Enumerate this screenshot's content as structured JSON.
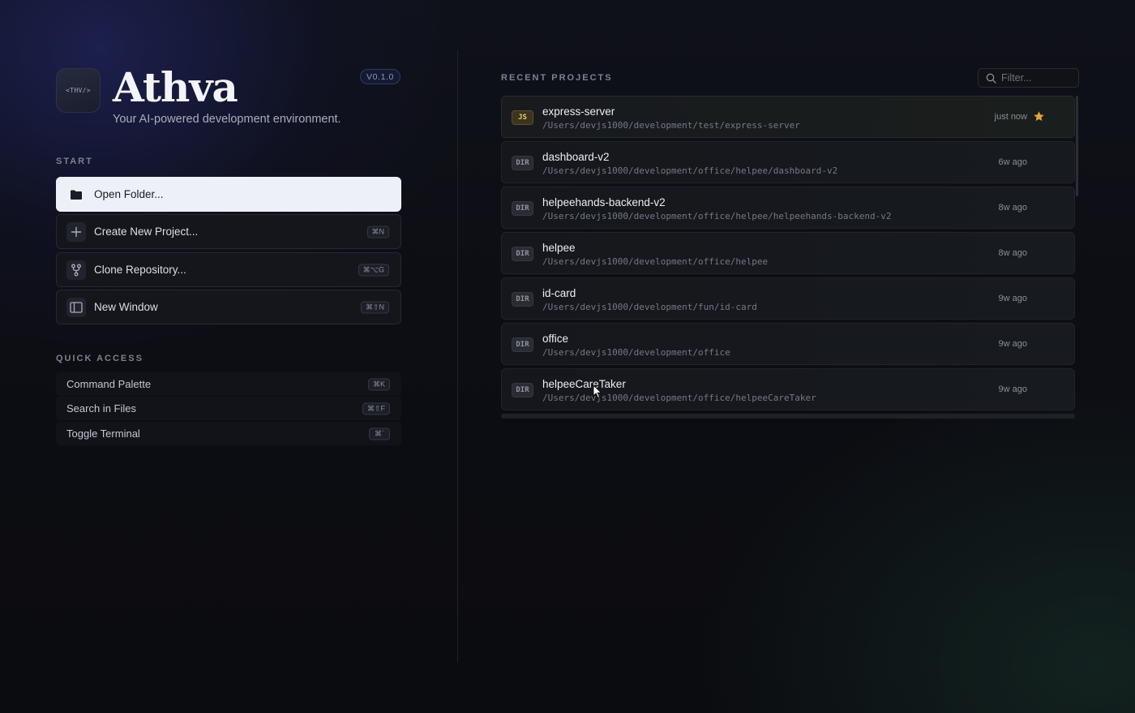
{
  "app": {
    "logo_text": "<THV/>",
    "title": "Athva",
    "tagline": "Your AI-powered development environment.",
    "version": "V0.1.0"
  },
  "start": {
    "label": "START",
    "items": [
      {
        "label": "Open Folder...",
        "icon": "folder-icon",
        "shortcut": ""
      },
      {
        "label": "Create New Project...",
        "icon": "plus-icon",
        "shortcut": "⌘N"
      },
      {
        "label": "Clone Repository...",
        "icon": "git-branch-icon",
        "shortcut": "⌘⌥G"
      },
      {
        "label": "New Window",
        "icon": "window-icon",
        "shortcut": "⌘⇧N"
      }
    ]
  },
  "quick_access": {
    "label": "QUICK ACCESS",
    "items": [
      {
        "label": "Command Palette",
        "shortcut": "⌘K"
      },
      {
        "label": "Search in Files",
        "shortcut": "⌘⇧F"
      },
      {
        "label": "Toggle Terminal",
        "shortcut": "⌘`"
      }
    ]
  },
  "recent": {
    "label": "RECENT PROJECTS",
    "filter_placeholder": "Filter...",
    "projects": [
      {
        "badge": "JS",
        "name": "express-server",
        "path": "/Users/devjs1000/development/test/express-server",
        "time": "just now",
        "starred": true
      },
      {
        "badge": "DIR",
        "name": "dashboard-v2",
        "path": "/Users/devjs1000/development/office/helpee/dashboard-v2",
        "time": "6w ago",
        "starred": false
      },
      {
        "badge": "DIR",
        "name": "helpeehands-backend-v2",
        "path": "/Users/devjs1000/development/office/helpee/helpeehands-backend-v2",
        "time": "8w ago",
        "starred": false
      },
      {
        "badge": "DIR",
        "name": "helpee",
        "path": "/Users/devjs1000/development/office/helpee",
        "time": "8w ago",
        "starred": false
      },
      {
        "badge": "DIR",
        "name": "id-card",
        "path": "/Users/devjs1000/development/fun/id-card",
        "time": "9w ago",
        "starred": false
      },
      {
        "badge": "DIR",
        "name": "office",
        "path": "/Users/devjs1000/development/office",
        "time": "9w ago",
        "starred": false
      },
      {
        "badge": "DIR",
        "name": "helpeeCareTaker",
        "path": "/Users/devjs1000/development/office/helpeeCareTaker",
        "time": "9w ago",
        "starred": false
      }
    ]
  },
  "colors": {
    "accent_star": "#e8a33d",
    "js_badge": "#e8cf5a",
    "primary_button": "#eef0f7"
  }
}
